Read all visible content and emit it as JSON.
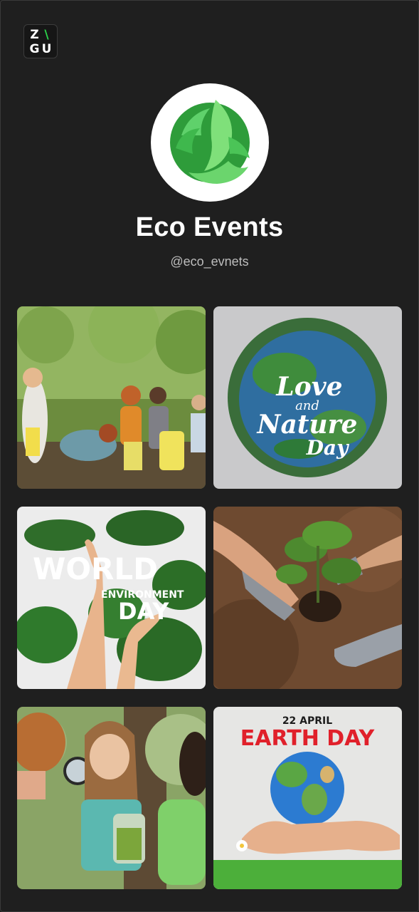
{
  "brand": {
    "logo_letters": [
      "Z",
      "\\",
      "G",
      "U"
    ]
  },
  "profile": {
    "name": "Eco Events",
    "handle": "@eco_evnets"
  },
  "posts": [
    {
      "id": "cleanup-photo",
      "text": ""
    },
    {
      "id": "love-nature-day",
      "line1": "Love",
      "line2": "and",
      "line3": "Nature",
      "line4": "Day"
    },
    {
      "id": "world-environment-day",
      "line1": "WORLD",
      "line2": "ENVIRONMENT",
      "line3": "DAY"
    },
    {
      "id": "planting-photo",
      "text": ""
    },
    {
      "id": "magnifier-kids-photo",
      "text": ""
    },
    {
      "id": "earth-day",
      "date": "22 APRIL",
      "title": "EARTH DAY"
    }
  ],
  "colors": {
    "background": "#1f1f1f",
    "accent_green": "#2bd44a",
    "earth_day_red": "#e0202a"
  }
}
